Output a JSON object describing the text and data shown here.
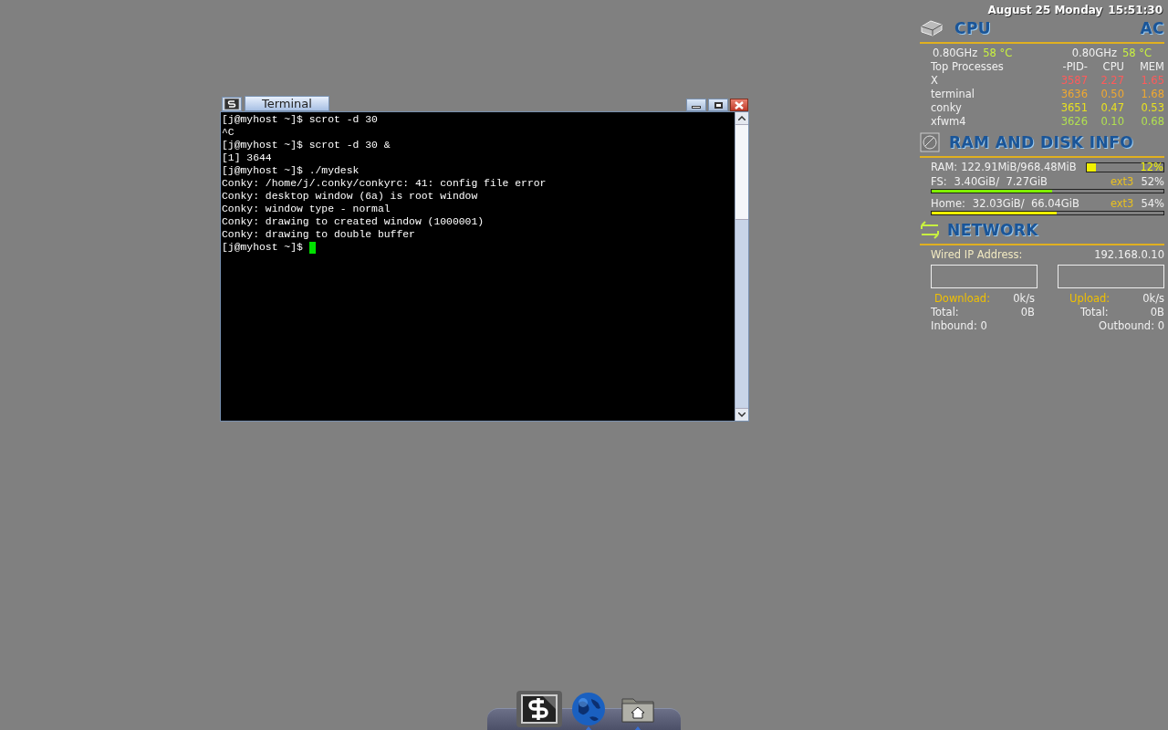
{
  "terminal": {
    "title": "Terminal",
    "lines": [
      "[j@myhost ~]$ scrot -d 30",
      "^C",
      "[j@myhost ~]$ scrot -d 30 &",
      "[1] 3644",
      "[j@myhost ~]$ ./mydesk",
      "Conky: /home/j/.conky/conkyrc: 41: config file error",
      "Conky: desktop window (6a) is root window",
      "Conky: window type - normal",
      "Conky: drawing to created window (1000001)",
      "Conky: drawing to double buffer"
    ],
    "prompt": "[j@myhost ~]$"
  },
  "conky": {
    "date": "August 25 Monday",
    "time": "15:51:30",
    "cpu": {
      "title": "CPU",
      "power": "AC",
      "cores": [
        {
          "freq": "0.80GHz",
          "temp": "58 °C"
        },
        {
          "freq": "0.80GHz",
          "temp": "58 °C"
        }
      ],
      "header": [
        "Top Processes",
        "-PID-",
        "CPU",
        "MEM"
      ],
      "processes": [
        {
          "name": "X",
          "pid": "3587",
          "cpu": "2.27",
          "mem": "1.65",
          "color": "#ff5a5a"
        },
        {
          "name": "terminal",
          "pid": "3636",
          "cpu": "0.50",
          "mem": "1.68",
          "color": "#f0a830"
        },
        {
          "name": "conky",
          "pid": "3651",
          "cpu": "0.47",
          "mem": "0.53",
          "color": "#e8e020"
        },
        {
          "name": "xfwm4",
          "pid": "3626",
          "cpu": "0.10",
          "mem": "0.68",
          "color": "#b0e050"
        }
      ]
    },
    "ram": {
      "title": "RAM AND DISK INFO",
      "memory": {
        "label": "RAM:",
        "value": "122.91MiB/968.48MiB",
        "percent": "12%",
        "level": 0.12
      },
      "disks": [
        {
          "label": "FS:",
          "value": "3.40GiB/  7.27GiB",
          "fs": "ext3",
          "percent": "52%",
          "level": 0.52,
          "color": "#80f000"
        },
        {
          "label": "Home:",
          "value": "32.03GiB/  66.04GiB",
          "fs": "ext3",
          "percent": "54%",
          "level": 0.54,
          "color": "#f0f000"
        }
      ]
    },
    "network": {
      "title": "NETWORK",
      "ip_label": "Wired IP Address:",
      "ip": "192.168.0.10",
      "down": {
        "label": "Download:",
        "rate": "0k/s",
        "total_label": "Total:",
        "total": "0B",
        "count_label": "Inbound: 0"
      },
      "up": {
        "label": "Upload:",
        "rate": "0k/s",
        "total_label": "Total:",
        "total": "0B",
        "count_label": "Outbound: 0"
      }
    }
  },
  "dock": [
    {
      "kind": "terminal",
      "selected": true,
      "running": false
    },
    {
      "kind": "globe",
      "selected": false,
      "running": true
    },
    {
      "kind": "home",
      "selected": false,
      "running": true
    }
  ]
}
